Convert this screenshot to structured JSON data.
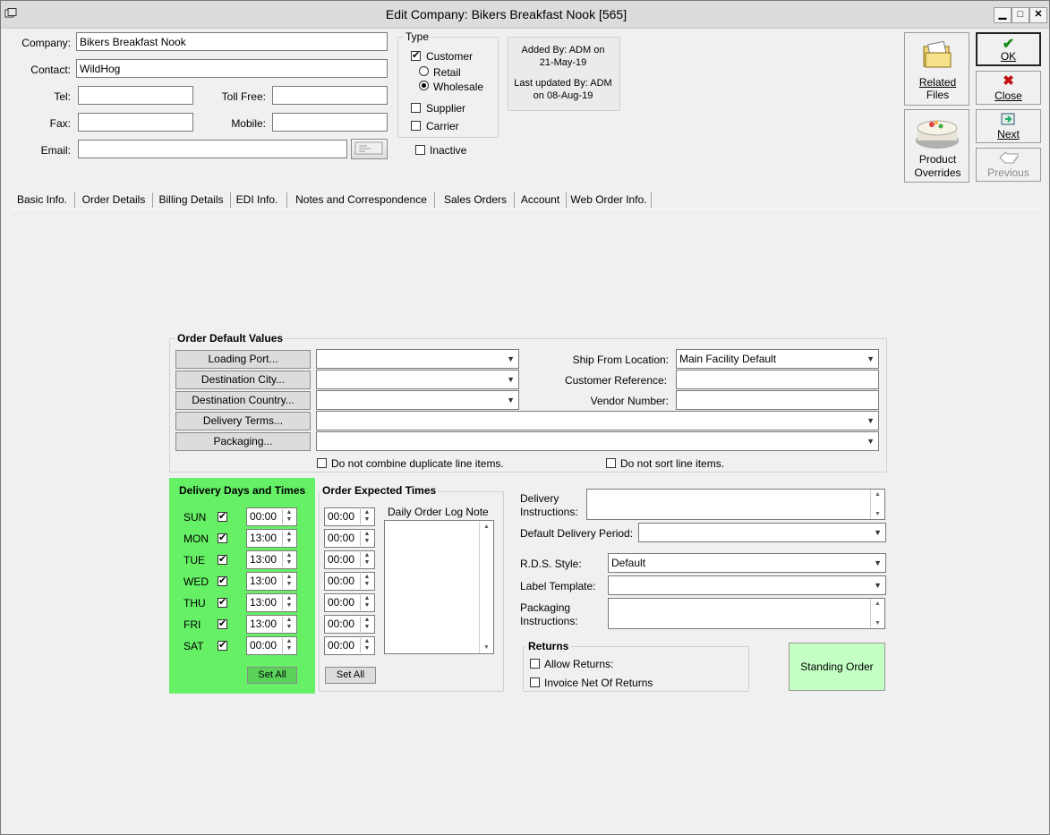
{
  "window": {
    "title": "Edit Company: Bikers Breakfast Nook [565]",
    "min_glyph": "▁",
    "max_glyph": "□",
    "close_glyph": "✕"
  },
  "company": {
    "company_label": "Company:",
    "company_value": "Bikers Breakfast Nook",
    "contact_label": "Contact:",
    "contact_value": "WildHog",
    "tel_label": "Tel:",
    "tel_value": "",
    "tollfree_label": "Toll Free:",
    "tollfree_value": "",
    "fax_label": "Fax:",
    "fax_value": "",
    "mobile_label": "Mobile:",
    "mobile_value": "",
    "email_label": "Email:",
    "email_value": ""
  },
  "type": {
    "title": "Type",
    "customer": "Customer",
    "retail": "Retail",
    "wholesale": "Wholesale",
    "supplier": "Supplier",
    "carrier": "Carrier",
    "inactive": "Inactive",
    "customer_checked": true,
    "supplier_checked": false,
    "carrier_checked": false,
    "inactive_checked": false,
    "selected_subtype": "Wholesale"
  },
  "audit": {
    "added_line1": "Added By: ADM on",
    "added_line2": "21-May-19",
    "updated_line1": "Last updated By: ADM",
    "updated_line2": "on 08-Aug-19"
  },
  "actions": {
    "related_files": "Related Files",
    "related_line1": "Related",
    "related_line2": "Files",
    "product_line1": "Product",
    "product_line2": "Overrides",
    "ok": "OK",
    "close": "Close",
    "next": "Next",
    "previous": "Previous"
  },
  "tabs": [
    "Basic Info.",
    "Order Details",
    "Billing Details",
    "EDI Info.",
    "Notes and Correspondence",
    "Sales Orders",
    "Account",
    "Web Order Info."
  ],
  "order_defaults": {
    "title": "Order Default Values",
    "loading_port": "Loading Port...",
    "destination_city": "Destination City...",
    "destination_country": "Destination Country...",
    "delivery_terms": "Delivery Terms...",
    "packaging": "Packaging...",
    "loading_port_value": "",
    "destination_city_value": "",
    "destination_country_value": "",
    "delivery_terms_value": "",
    "packaging_value": "",
    "ship_from_label": "Ship From Location:",
    "ship_from_value": "Main Facility Default",
    "customer_ref_label": "Customer Reference:",
    "customer_ref_value": "",
    "vendor_number_label": "Vendor Number:",
    "vendor_number_value": "",
    "no_combine": "Do not combine duplicate line items.",
    "no_sort": "Do not sort line items."
  },
  "delivery_days": {
    "title": "Delivery Days and Times",
    "set_all": "Set All",
    "highlight_color": "#66f066",
    "days": [
      {
        "day": "SUN",
        "checked": true,
        "time": "00:00"
      },
      {
        "day": "MON",
        "checked": true,
        "time": "13:00"
      },
      {
        "day": "TUE",
        "checked": true,
        "time": "13:00"
      },
      {
        "day": "WED",
        "checked": true,
        "time": "13:00"
      },
      {
        "day": "THU",
        "checked": true,
        "time": "13:00"
      },
      {
        "day": "FRI",
        "checked": true,
        "time": "13:00"
      },
      {
        "day": "SAT",
        "checked": true,
        "time": "00:00"
      }
    ]
  },
  "expected_times": {
    "title": "Order Expected Times",
    "log_note_label": "Daily Order Log Note",
    "set_all": "Set All",
    "times": [
      "00:00",
      "00:00",
      "00:00",
      "00:00",
      "00:00",
      "00:00",
      "00:00"
    ]
  },
  "delivery": {
    "instructions_line1": "Delivery",
    "instructions_line2": "Instructions:",
    "default_period_label": "Default Delivery Period:",
    "default_period_value": "",
    "rds_label": "R.D.S. Style:",
    "rds_value": "Default",
    "label_template_label": "Label Template:",
    "label_template_value": "",
    "packaging_line1": "Packaging",
    "packaging_line2": "Instructions:"
  },
  "returns": {
    "title": "Returns",
    "allow": "Allow Returns:",
    "invoice_net": "Invoice Net Of Returns"
  },
  "standing_order": {
    "label": "Standing Order",
    "color": "#c4ffc4"
  }
}
